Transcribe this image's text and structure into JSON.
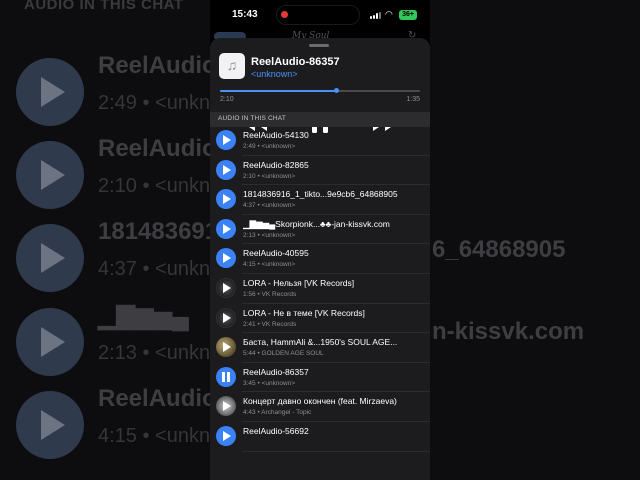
{
  "status_bar": {
    "time": "15:43",
    "battery": "36+"
  },
  "background_chat": {
    "header": "AUDIO IN THIS CHAT",
    "nav_title": "My Soul",
    "rows": [
      {
        "title": "ReelAudio",
        "sub": "2:49 • <unkn"
      },
      {
        "title": "ReelAudio",
        "sub": "2:10 • <unkn"
      },
      {
        "title": "181483691",
        "sub": "4:37 • <unkn"
      },
      {
        "title": "▁▇▆▅▄",
        "sub": "2:13 • <unkn"
      },
      {
        "title": "ReelAudio",
        "sub": "4:15 • <unkn"
      }
    ],
    "right_text_1": "6_64868905",
    "right_text_2": "n-kissvk.com"
  },
  "player": {
    "title": "ReelAudio-86357",
    "artist": "<unknown>",
    "elapsed": "2:10",
    "duration": "1:35",
    "progress": 0.58,
    "art_icon": "music-note-icon"
  },
  "section_header": "AUDIO IN THIS CHAT",
  "tracks": [
    {
      "title": "ReelAudio-54130",
      "meta": "2:49 • <unknown>",
      "icon": "play"
    },
    {
      "title": "ReelAudio-82865",
      "meta": "2:10 • <unknown>",
      "icon": "play"
    },
    {
      "title": "1814836916_1_tikto...9e9cb6_64868905",
      "meta": "4:37 • <unknown>",
      "icon": "play"
    },
    {
      "title": "▁▇▆▅▄Skorpionk...♣♣-jan-kissvk.com",
      "meta": "2:13 • <unknown>",
      "icon": "play"
    },
    {
      "title": "ReelAudio-40595",
      "meta": "4:15 • <unknown>",
      "icon": "play"
    },
    {
      "title": "LORA - Нельзя [VK Records]",
      "meta": "1:56 • VK Records",
      "icon": "thumb-1"
    },
    {
      "title": "LORA - Не в теме [VK Records]",
      "meta": "2:41 • VK Records",
      "icon": "thumb-1"
    },
    {
      "title": "Баста, HammAli &...1950's SOUL AGE...",
      "meta": "5:44 • GOLDEN AGE SOUL",
      "icon": "thumb-2"
    },
    {
      "title": "ReelAudio-86357",
      "meta": "3:45 • <unknown>",
      "icon": "pause"
    },
    {
      "title": "Концерт давно окончен (feat. Mirzaeva)",
      "meta": "4:43 • Archangel - Topic",
      "icon": "thumb-3"
    },
    {
      "title": "ReelAudio-56692",
      "meta": "",
      "icon": "play"
    }
  ]
}
